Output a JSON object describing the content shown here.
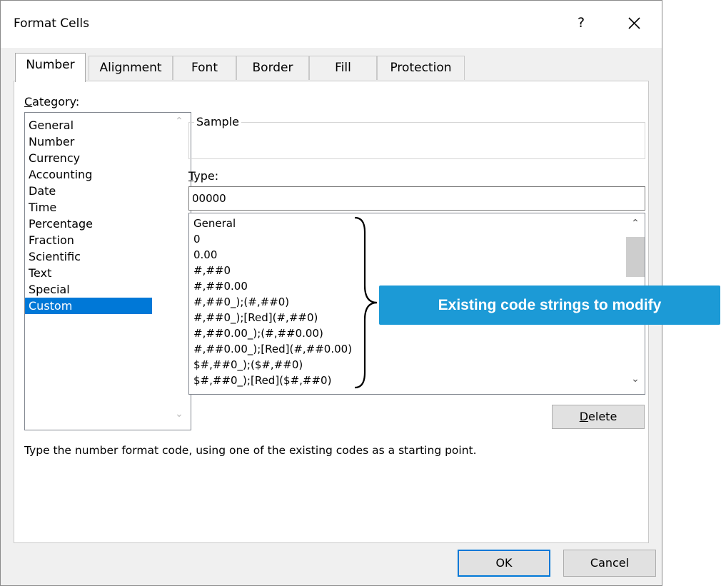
{
  "window": {
    "title": "Format Cells",
    "help_label": "?"
  },
  "tabs": [
    {
      "label": "Number"
    },
    {
      "label": "Alignment"
    },
    {
      "label": "Font"
    },
    {
      "label": "Border"
    },
    {
      "label": "Fill"
    },
    {
      "label": "Protection"
    }
  ],
  "category": {
    "label_first": "C",
    "label_rest": "ategory:",
    "items": [
      "General",
      "Number",
      "Currency",
      "Accounting",
      "Date",
      "Time",
      "Percentage",
      "Fraction",
      "Scientific",
      "Text",
      "Special",
      "Custom"
    ],
    "selected": "Custom"
  },
  "sample": {
    "legend": "Sample"
  },
  "type": {
    "label_first": "T",
    "label_rest": "ype:",
    "value": "00000"
  },
  "format_codes": [
    "General",
    "0",
    "0.00",
    "#,##0",
    "#,##0.00",
    "#,##0_);(#,##0)",
    "#,##0_);[Red](#,##0)",
    "#,##0.00_);(#,##0.00)",
    "#,##0.00_);[Red](#,##0.00)",
    "$#,##0_);($#,##0)",
    "$#,##0_);[Red]($#,##0)"
  ],
  "delete_button": {
    "label_first": "D",
    "label_rest": "elete"
  },
  "hint_text": "Type the number format code, using one of the existing codes as a starting point.",
  "ok_label": "OK",
  "cancel_label": "Cancel",
  "callout_text": "Existing code strings to modify",
  "colors": {
    "accent": "#0078d7",
    "callout": "#1c9ad6"
  }
}
